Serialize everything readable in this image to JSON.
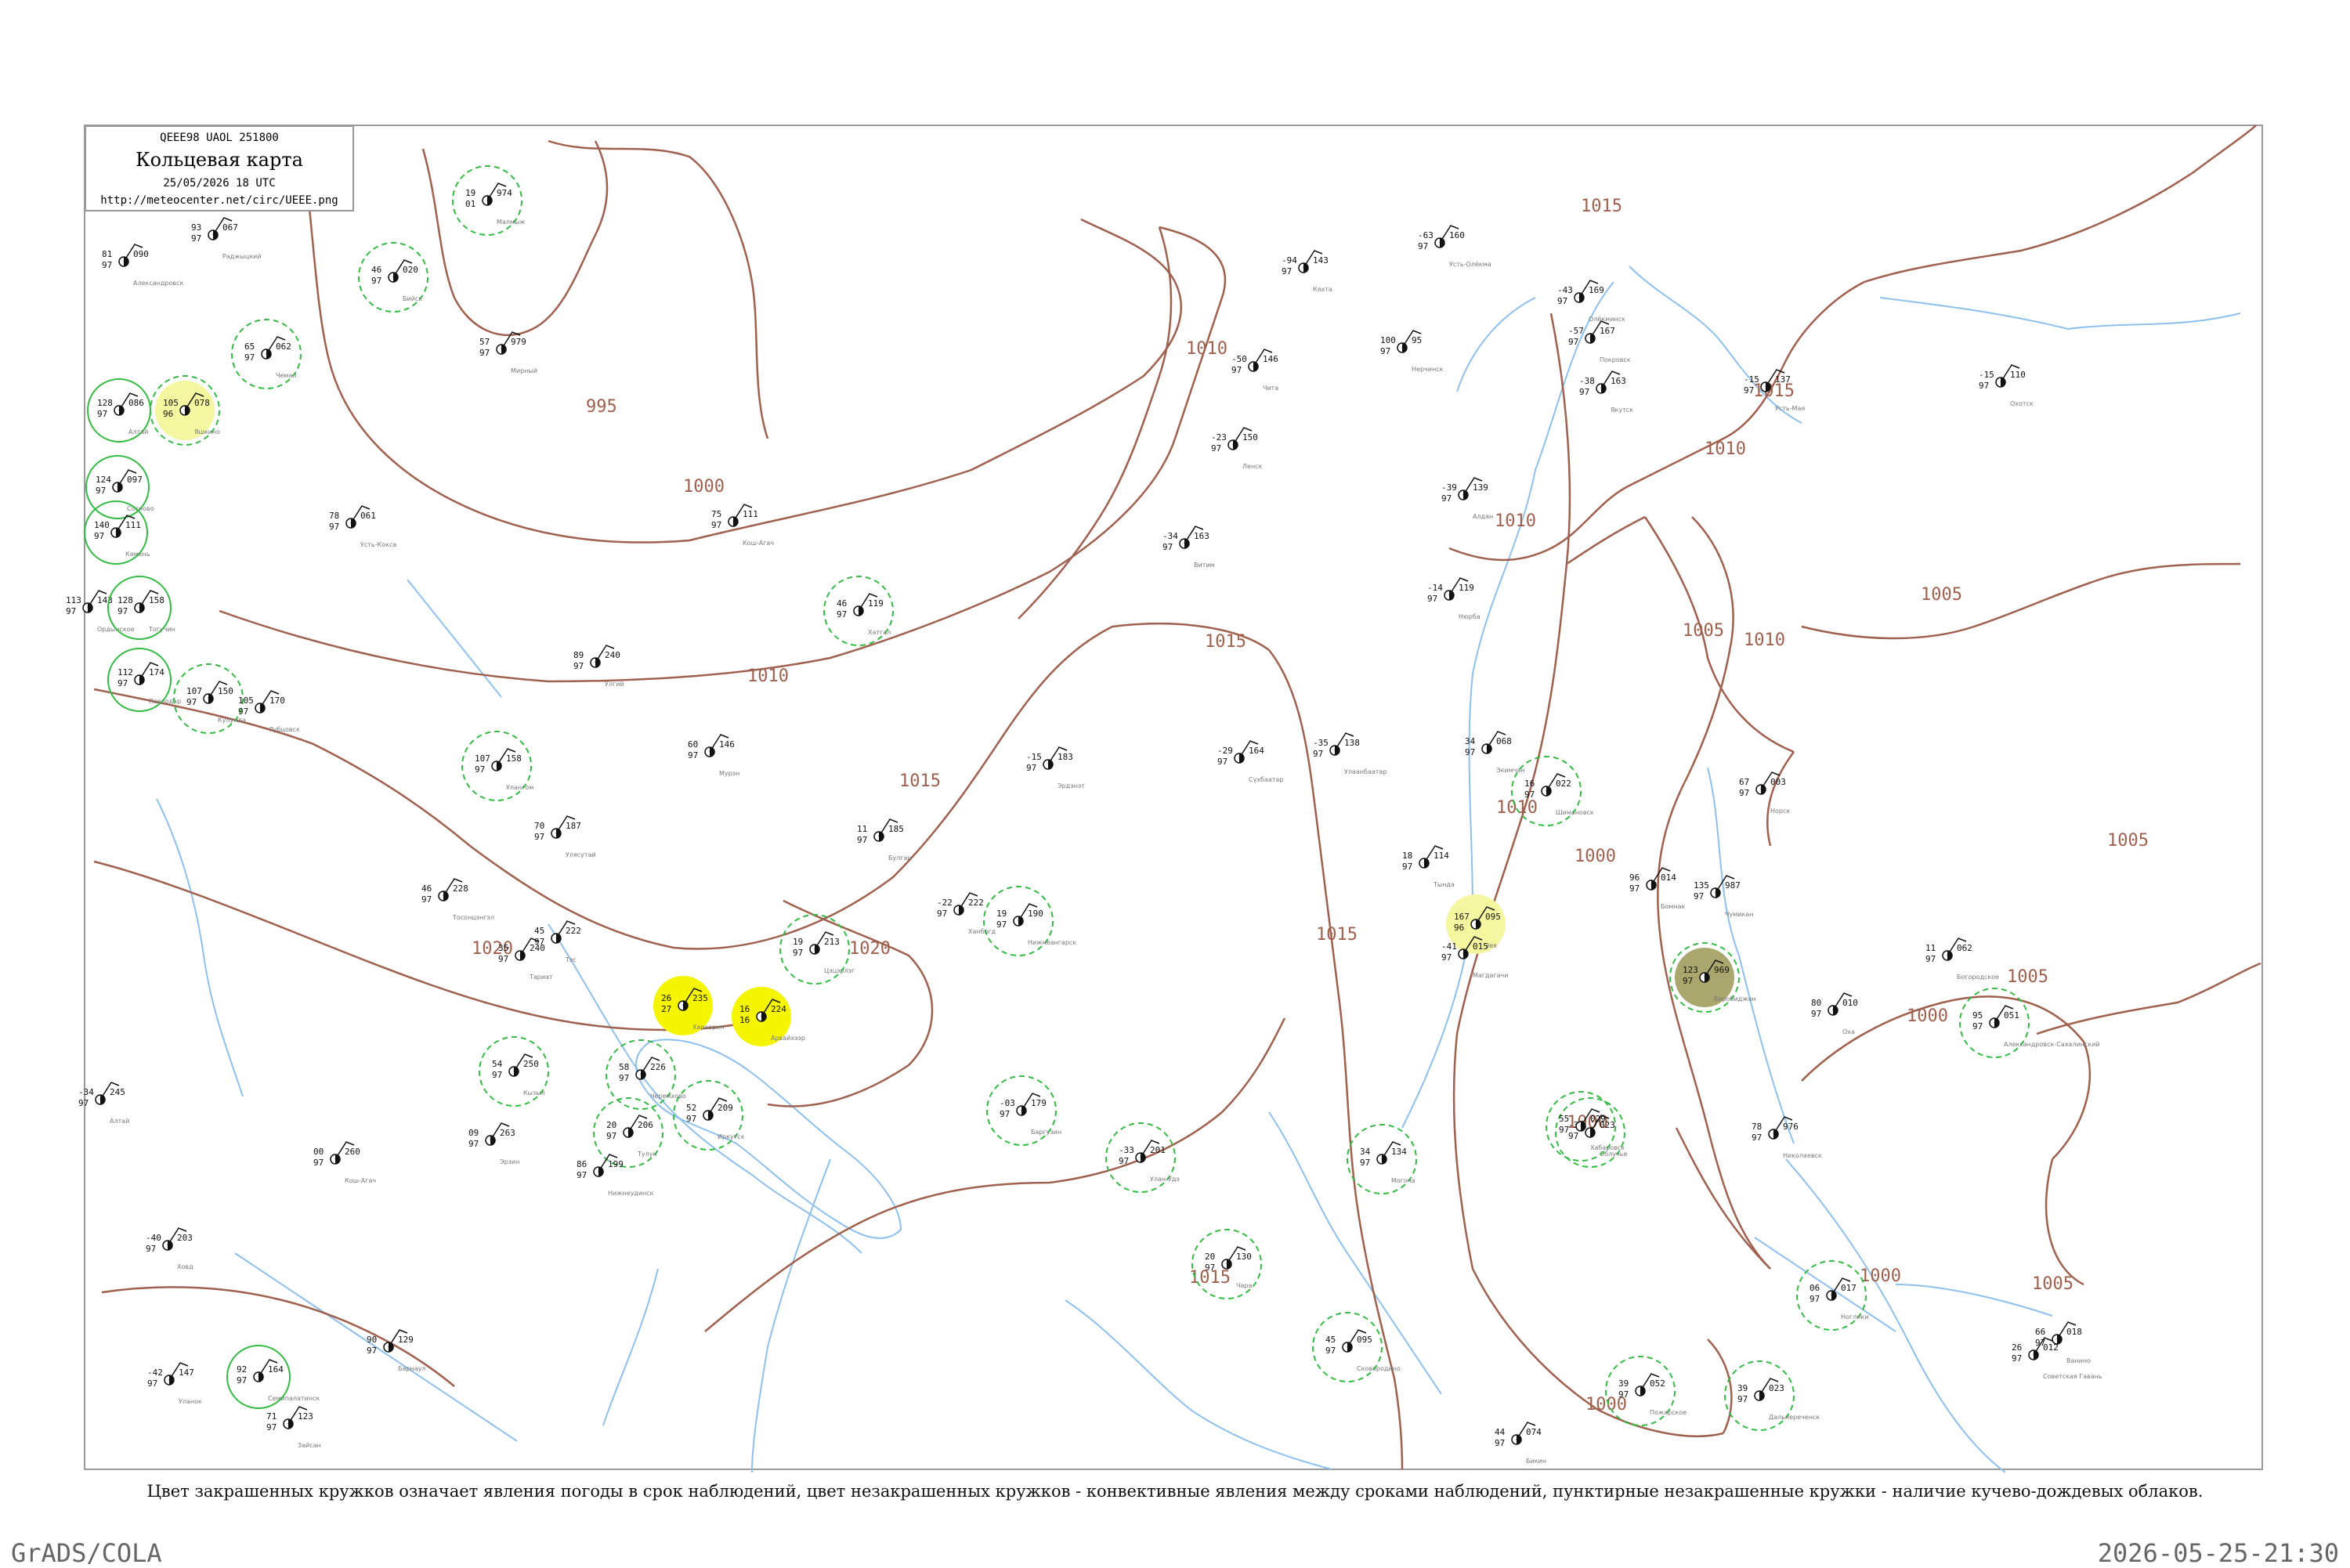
{
  "header": {
    "product_code": "QEEE98  UAOL  251800",
    "title": "Кольцевая карта",
    "datetime": "25/05/2026 18 UTC",
    "url": "http://meteocenter.net/circ/UEEE.png"
  },
  "caption": "Цвет закрашенных кружков означает явления погоды в срок наблюдений, цвет незакрашенных кружков - конвективные явления между сроками наблюдений, пунктирные незакрашенные кружки - наличие кучево-дождевых облаков.",
  "footer": {
    "software": "GrADS/COLA",
    "timestamp": "2026-05-25-21:30"
  },
  "colors": {
    "isobar": "#a0604e",
    "river": "#8ec0ee",
    "shower_rain": "#0cc432",
    "thunderstorm": "#f5f500",
    "snow": "#2277ee",
    "mist_haze": "#a9a66e",
    "light_yellow": "#f4f7a0",
    "cyan": "#2de0c0",
    "mint": "#66ee99",
    "dashed_ring": "#33bb44"
  },
  "isobar_labels": [
    {
      "text": "995"
    },
    {
      "text": "1000"
    },
    {
      "text": "1010"
    },
    {
      "text": "1015"
    },
    {
      "text": "1010"
    },
    {
      "text": "1015"
    },
    {
      "text": "1010"
    },
    {
      "text": "1015"
    },
    {
      "text": "1020"
    },
    {
      "text": "1020"
    },
    {
      "text": "1015"
    },
    {
      "text": "1015"
    },
    {
      "text": "1015"
    },
    {
      "text": "1010"
    },
    {
      "text": "1010"
    },
    {
      "text": "1010"
    },
    {
      "text": "1005"
    },
    {
      "text": "1005"
    },
    {
      "text": "1000"
    },
    {
      "text": "1000"
    },
    {
      "text": "1005"
    },
    {
      "text": "1005"
    },
    {
      "text": "1000"
    },
    {
      "text": "1000"
    },
    {
      "text": "1000"
    },
    {
      "text": "1005"
    }
  ],
  "stations": [
    {
      "temp": "19",
      "dew": "01",
      "press": "974",
      "name": "Малмыж",
      "fill": "",
      "ring": "dashed"
    },
    {
      "temp": "93",
      "dew": "97",
      "press": "067",
      "name": "Раджыцкий",
      "fill": "",
      "ring": ""
    },
    {
      "temp": "81",
      "dew": "97",
      "press": "090",
      "name": "Александровск",
      "fill": "",
      "ring": ""
    },
    {
      "temp": "65",
      "dew": "97",
      "press": "062",
      "name": "Чемал",
      "fill": "",
      "ring": "dashed"
    },
    {
      "temp": "128",
      "dew": "97",
      "press": "086",
      "name": "Алтай",
      "fill": "",
      "ring": "solid"
    },
    {
      "temp": "105",
      "dew": "96",
      "press": "078",
      "name": "Яшкино",
      "fill": "light_yellow",
      "ring": "dashed"
    },
    {
      "temp": "124",
      "dew": "97",
      "press": "097",
      "name": "Сосново",
      "fill": "",
      "ring": "solid"
    },
    {
      "temp": "140",
      "dew": "97",
      "press": "111",
      "name": "Камень",
      "fill": "",
      "ring": "solid"
    },
    {
      "temp": "113",
      "dew": "97",
      "press": "143",
      "name": "Ордынское",
      "fill": "",
      "ring": ""
    },
    {
      "temp": "128",
      "dew": "97",
      "press": "158",
      "name": "Тогучин",
      "fill": "",
      "ring": "solid"
    },
    {
      "temp": "112",
      "dew": "97",
      "press": "174",
      "name": "Павлодар",
      "fill": "",
      "ring": "solid"
    },
    {
      "temp": "107",
      "dew": "97",
      "press": "150",
      "name": "Кулунда",
      "fill": "",
      "ring": "dashed"
    },
    {
      "temp": "105",
      "dew": "97",
      "press": "170",
      "name": "Рубцовск",
      "fill": "",
      "ring": ""
    },
    {
      "temp": "78",
      "dew": "97",
      "press": "061",
      "name": "Усть-Кокса",
      "fill": "",
      "ring": ""
    },
    {
      "temp": "46",
      "dew": "97",
      "press": "020",
      "name": "Бийск",
      "fill": "",
      "ring": "dashed"
    },
    {
      "temp": "57",
      "dew": "97",
      "press": "979",
      "name": "Мирный",
      "fill": "",
      "ring": ""
    },
    {
      "temp": "75",
      "dew": "97",
      "press": "111",
      "name": "Кош-Агач",
      "fill": "",
      "ring": ""
    },
    {
      "temp": "89",
      "dew": "97",
      "press": "240",
      "name": "Улгий",
      "fill": "",
      "ring": ""
    },
    {
      "temp": "46",
      "dew": "97",
      "press": "119",
      "name": "Хатгал",
      "fill": "",
      "ring": "dashed"
    },
    {
      "temp": "60",
      "dew": "97",
      "press": "146",
      "name": "Мурэн",
      "fill": "",
      "ring": ""
    },
    {
      "temp": "107",
      "dew": "97",
      "press": "158",
      "name": "Улангом",
      "fill": "",
      "ring": "dashed"
    },
    {
      "temp": "70",
      "dew": "97",
      "press": "187",
      "name": "Улясутай",
      "fill": "",
      "ring": ""
    },
    {
      "temp": "46",
      "dew": "97",
      "press": "228",
      "name": "Тосонцэнгэл",
      "fill": "",
      "ring": ""
    },
    {
      "temp": "45",
      "dew": "97",
      "press": "222",
      "name": "Тэс",
      "fill": "",
      "ring": ""
    },
    {
      "temp": "35",
      "dew": "97",
      "press": "240",
      "name": "Тариат",
      "fill": "",
      "ring": ""
    },
    {
      "temp": "26",
      "dew": "27",
      "press": "235",
      "name": "Хархорин",
      "fill": "thunderstorm",
      "ring": ""
    },
    {
      "temp": "16",
      "dew": "16",
      "press": "224",
      "name": "Арвайхээр",
      "fill": "thunderstorm",
      "ring": ""
    },
    {
      "temp": "19",
      "dew": "97",
      "press": "213",
      "name": "Цэцэрлэг",
      "fill": "",
      "ring": "dashed"
    },
    {
      "temp": "11",
      "dew": "97",
      "press": "185",
      "name": "Булган",
      "fill": "",
      "ring": ""
    },
    {
      "temp": "-15",
      "dew": "97",
      "press": "183",
      "name": "Эрдэнэт",
      "fill": "",
      "ring": ""
    },
    {
      "temp": "-29",
      "dew": "97",
      "press": "164",
      "name": "Сүхбаатар",
      "fill": "",
      "ring": ""
    },
    {
      "temp": "-35",
      "dew": "97",
      "press": "138",
      "name": "Улаанбаатар",
      "fill": "",
      "ring": ""
    },
    {
      "temp": "-94",
      "dew": "97",
      "press": "143",
      "name": "Кяхта",
      "fill": "",
      "ring": ""
    },
    {
      "temp": "-50",
      "dew": "97",
      "press": "146",
      "name": "Чита",
      "fill": "",
      "ring": ""
    },
    {
      "temp": "100",
      "dew": "97",
      "press": "95",
      "name": "Нерчинск",
      "fill": "",
      "ring": ""
    },
    {
      "temp": "-63",
      "dew": "97",
      "press": "160",
      "name": "Усть-Олёкма",
      "fill": "",
      "ring": ""
    },
    {
      "temp": "-43",
      "dew": "97",
      "press": "169",
      "name": "Олёкминск",
      "fill": "",
      "ring": ""
    },
    {
      "temp": "-57",
      "dew": "97",
      "press": "167",
      "name": "Покровск",
      "fill": "",
      "ring": ""
    },
    {
      "temp": "-38",
      "dew": "97",
      "press": "163",
      "name": "Якутск",
      "fill": "",
      "ring": ""
    },
    {
      "temp": "-15",
      "dew": "97",
      "press": "137",
      "name": "Усть-Мая",
      "fill": "",
      "ring": ""
    },
    {
      "temp": "-15",
      "dew": "97",
      "press": "110",
      "name": "Охотск",
      "fill": "",
      "ring": ""
    },
    {
      "temp": "-23",
      "dew": "97",
      "press": "150",
      "name": "Ленск",
      "fill": "",
      "ring": ""
    },
    {
      "temp": "-34",
      "dew": "97",
      "press": "163",
      "name": "Витим",
      "fill": "",
      "ring": ""
    },
    {
      "temp": "-39",
      "dew": "97",
      "press": "139",
      "name": "Алдан",
      "fill": "",
      "ring": ""
    },
    {
      "temp": "-14",
      "dew": "97",
      "press": "119",
      "name": "Нюрба",
      "fill": "",
      "ring": ""
    },
    {
      "temp": "18",
      "dew": "97",
      "press": "114",
      "name": "Тында",
      "fill": "",
      "ring": ""
    },
    {
      "temp": "167",
      "dew": "96",
      "press": "095",
      "name": "Зея",
      "fill": "light_yellow",
      "ring": ""
    },
    {
      "temp": "-41",
      "dew": "97",
      "press": "015",
      "name": "Магдагачи",
      "fill": "",
      "ring": ""
    },
    {
      "temp": "34",
      "dew": "97",
      "press": "068",
      "name": "Экимчан",
      "fill": "",
      "ring": ""
    },
    {
      "temp": "16",
      "dew": "97",
      "press": "022",
      "name": "Шимановск",
      "fill": "",
      "ring": "dashed"
    },
    {
      "temp": "96",
      "dew": "97",
      "press": "014",
      "name": "Бомнак",
      "fill": "",
      "ring": ""
    },
    {
      "temp": "135",
      "dew": "97",
      "press": "987",
      "name": "Чумикан",
      "fill": "",
      "ring": ""
    },
    {
      "temp": "67",
      "dew": "97",
      "press": "003",
      "name": "Норск",
      "fill": "",
      "ring": ""
    },
    {
      "temp": "78",
      "dew": "97",
      "press": "976",
      "name": "Николаевск",
      "fill": "",
      "ring": ""
    },
    {
      "temp": "-37",
      "dew": "97",
      "press": "023",
      "name": "Облучье",
      "fill": "",
      "ring": "dashed"
    },
    {
      "temp": "123",
      "dew": "97",
      "press": "969",
      "name": "Биробиджан",
      "fill": "mist_haze",
      "ring": "dashed"
    },
    {
      "temp": "55",
      "dew": "97",
      "press": "029",
      "name": "Хабаровск",
      "fill": "",
      "ring": "dashed"
    },
    {
      "temp": "44",
      "dew": "97",
      "press": "074",
      "name": "Бикин",
      "fill": "",
      "ring": ""
    },
    {
      "temp": "39",
      "dew": "97",
      "press": "052",
      "name": "Пожарское",
      "fill": "",
      "ring": "dashed"
    },
    {
      "temp": "39",
      "dew": "97",
      "press": "023",
      "name": "Дальнереченск",
      "fill": "",
      "ring": "dashed"
    },
    {
      "temp": "26",
      "dew": "97",
      "press": "012",
      "name": "Советская Гавань",
      "fill": "",
      "ring": ""
    },
    {
      "temp": "66",
      "dew": "97",
      "press": "018",
      "name": "Ванино",
      "fill": "",
      "ring": ""
    },
    {
      "temp": "06",
      "dew": "97",
      "press": "017",
      "name": "Ноглики",
      "fill": "",
      "ring": "dashed"
    },
    {
      "temp": "95",
      "dew": "97",
      "press": "051",
      "name": "Александровск-Сахалинский",
      "fill": "",
      "ring": "dashed"
    },
    {
      "temp": "80",
      "dew": "97",
      "press": "010",
      "name": "Оха",
      "fill": "",
      "ring": ""
    },
    {
      "temp": "11",
      "dew": "97",
      "press": "062",
      "name": "Богородское",
      "fill": "",
      "ring": ""
    },
    {
      "temp": "45",
      "dew": "97",
      "press": "095",
      "name": "Сковородино",
      "fill": "",
      "ring": "dashed"
    },
    {
      "temp": "20",
      "dew": "97",
      "press": "130",
      "name": "Чара",
      "fill": "",
      "ring": "dashed"
    },
    {
      "temp": "34",
      "dew": "97",
      "press": "134",
      "name": "Могоча",
      "fill": "",
      "ring": "dashed"
    },
    {
      "temp": "-33",
      "dew": "97",
      "press": "201",
      "name": "Улан-Удэ",
      "fill": "",
      "ring": "dashed"
    },
    {
      "temp": "-03",
      "dew": "97",
      "press": "179",
      "name": "Баргузин",
      "fill": "",
      "ring": "dashed"
    },
    {
      "temp": "19",
      "dew": "97",
      "press": "190",
      "name": "Нижнеангарск",
      "fill": "",
      "ring": "dashed"
    },
    {
      "temp": "52",
      "dew": "97",
      "press": "209",
      "name": "Иркутск",
      "fill": "",
      "ring": "dashed"
    },
    {
      "temp": "58",
      "dew": "97",
      "press": "226",
      "name": "Черемхово",
      "fill": "",
      "ring": "dashed"
    },
    {
      "temp": "20",
      "dew": "97",
      "press": "206",
      "name": "Тулун",
      "fill": "",
      "ring": "dashed"
    },
    {
      "temp": "86",
      "dew": "97",
      "press": "199",
      "name": "Нижнеудинск",
      "fill": "",
      "ring": ""
    },
    {
      "temp": "54",
      "dew": "97",
      "press": "250",
      "name": "Кызыл",
      "fill": "",
      "ring": "dashed"
    },
    {
      "temp": "09",
      "dew": "97",
      "press": "263",
      "name": "Эрзин",
      "fill": "",
      "ring": ""
    },
    {
      "temp": "00",
      "dew": "97",
      "press": "260",
      "name": "Кош-Агач",
      "fill": "",
      "ring": ""
    },
    {
      "temp": "-40",
      "dew": "97",
      "press": "203",
      "name": "Ховд",
      "fill": "",
      "ring": ""
    },
    {
      "temp": "90",
      "dew": "97",
      "press": "129",
      "name": "Барнаул",
      "fill": "",
      "ring": ""
    },
    {
      "temp": "92",
      "dew": "97",
      "press": "164",
      "name": "Семипалатинск",
      "fill": "",
      "ring": "solid"
    },
    {
      "temp": "71",
      "dew": "97",
      "press": "123",
      "name": "Зайсан",
      "fill": "",
      "ring": ""
    },
    {
      "temp": "-42",
      "dew": "97",
      "press": "147",
      "name": "Уланок",
      "fill": "",
      "ring": ""
    },
    {
      "temp": "-22",
      "dew": "97",
      "press": "222",
      "name": "Ханбогд",
      "fill": "",
      "ring": ""
    },
    {
      "temp": "-34",
      "dew": "97",
      "press": "245",
      "name": "Алтай",
      "fill": "",
      "ring": ""
    }
  ]
}
